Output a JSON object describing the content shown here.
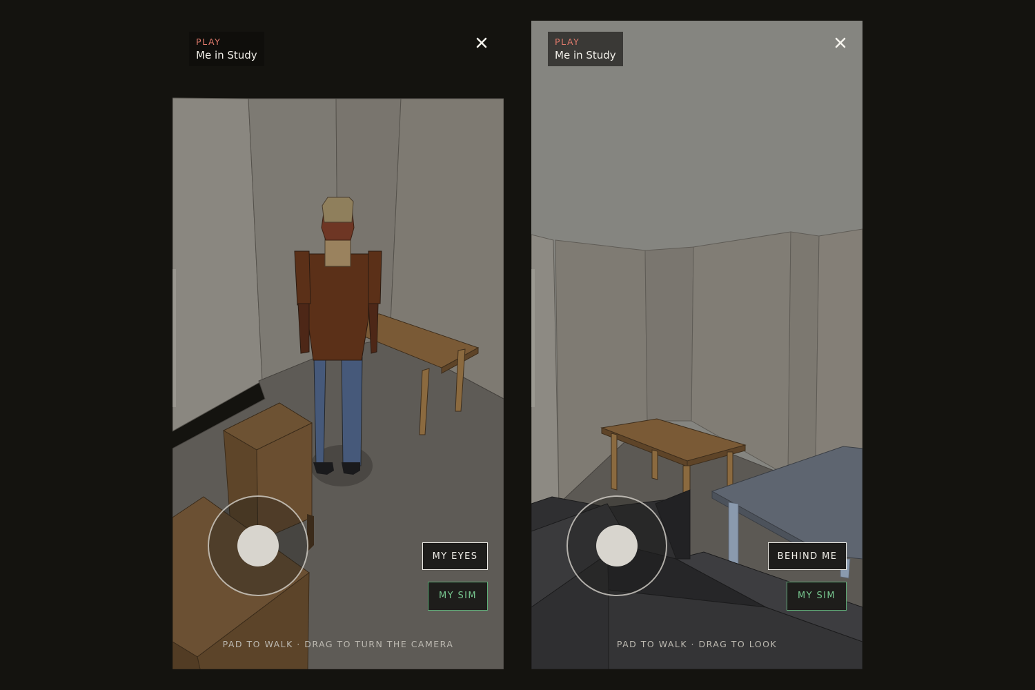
{
  "panels": [
    {
      "mode_label": "PLAY",
      "scene_title": "Me in Study",
      "camera_button_label": "MY EYES",
      "sim_button_label": "MY SIM",
      "hint": "PAD TO WALK · DRAG TO TURN THE CAMERA"
    },
    {
      "mode_label": "PLAY",
      "scene_title": "Me in Study",
      "camera_button_label": "BEHIND ME",
      "sim_button_label": "MY SIM",
      "hint": "PAD TO WALK · DRAG TO LOOK"
    }
  ],
  "icons": {
    "close": "close-icon",
    "joystick": "joystick-pad"
  },
  "colors": {
    "background": "#14130f",
    "mode_label": "#e07a6c",
    "sim_accent": "#5fae78",
    "wall": "#7d7971",
    "floor": "#5d5a55",
    "desk_wood": "#6b4f30",
    "avatar_shirt": "#5c3119",
    "avatar_jeans": "#465a73"
  }
}
